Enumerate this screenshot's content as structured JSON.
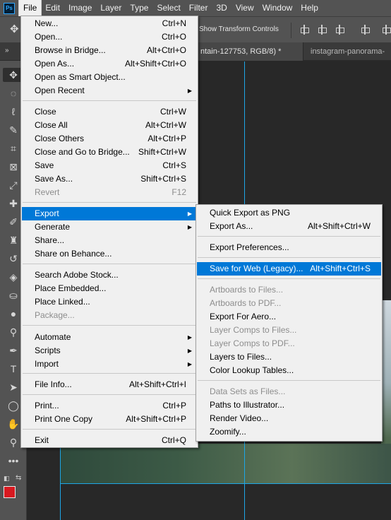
{
  "app": {
    "logo_text": "Ps"
  },
  "menubar": [
    "File",
    "Edit",
    "Image",
    "Layer",
    "Type",
    "Select",
    "Filter",
    "3D",
    "View",
    "Window",
    "Help"
  ],
  "options": {
    "transform_label": "Show Transform Controls"
  },
  "tabs": {
    "active": "ntain-127753, RGB/8) *",
    "inactive": "instagram-panorama-"
  },
  "file_menu": {
    "new": {
      "label": "New...",
      "shortcut": "Ctrl+N"
    },
    "open": {
      "label": "Open...",
      "shortcut": "Ctrl+O"
    },
    "browse_bridge": {
      "label": "Browse in Bridge...",
      "shortcut": "Alt+Ctrl+O"
    },
    "open_as": {
      "label": "Open As...",
      "shortcut": "Alt+Shift+Ctrl+O"
    },
    "open_smart": {
      "label": "Open as Smart Object..."
    },
    "open_recent": {
      "label": "Open Recent"
    },
    "close": {
      "label": "Close",
      "shortcut": "Ctrl+W"
    },
    "close_all": {
      "label": "Close All",
      "shortcut": "Alt+Ctrl+W"
    },
    "close_others": {
      "label": "Close Others",
      "shortcut": "Alt+Ctrl+P"
    },
    "close_bridge": {
      "label": "Close and Go to Bridge...",
      "shortcut": "Shift+Ctrl+W"
    },
    "save": {
      "label": "Save",
      "shortcut": "Ctrl+S"
    },
    "save_as": {
      "label": "Save As...",
      "shortcut": "Shift+Ctrl+S"
    },
    "revert": {
      "label": "Revert",
      "shortcut": "F12"
    },
    "export": {
      "label": "Export"
    },
    "generate": {
      "label": "Generate"
    },
    "share": {
      "label": "Share..."
    },
    "share_behance": {
      "label": "Share on Behance..."
    },
    "search_stock": {
      "label": "Search Adobe Stock..."
    },
    "place_embedded": {
      "label": "Place Embedded..."
    },
    "place_linked": {
      "label": "Place Linked..."
    },
    "package": {
      "label": "Package..."
    },
    "automate": {
      "label": "Automate"
    },
    "scripts": {
      "label": "Scripts"
    },
    "import": {
      "label": "Import"
    },
    "file_info": {
      "label": "File Info...",
      "shortcut": "Alt+Shift+Ctrl+I"
    },
    "print": {
      "label": "Print...",
      "shortcut": "Ctrl+P"
    },
    "print_one": {
      "label": "Print One Copy",
      "shortcut": "Alt+Shift+Ctrl+P"
    },
    "exit": {
      "label": "Exit",
      "shortcut": "Ctrl+Q"
    }
  },
  "export_menu": {
    "quick_export": {
      "label": "Quick Export as PNG"
    },
    "export_as": {
      "label": "Export As...",
      "shortcut": "Alt+Shift+Ctrl+W"
    },
    "export_prefs": {
      "label": "Export Preferences..."
    },
    "save_web": {
      "label": "Save for Web (Legacy)...",
      "shortcut": "Alt+Shift+Ctrl+S"
    },
    "artboards_files": {
      "label": "Artboards to Files..."
    },
    "artboards_pdf": {
      "label": "Artboards to PDF..."
    },
    "export_aero": {
      "label": "Export For Aero..."
    },
    "layer_comps_files": {
      "label": "Layer Comps to Files..."
    },
    "layer_comps_pdf": {
      "label": "Layer Comps to PDF..."
    },
    "layers_files": {
      "label": "Layers to Files..."
    },
    "color_lookup": {
      "label": "Color Lookup Tables..."
    },
    "data_sets": {
      "label": "Data Sets as Files..."
    },
    "paths_illustrator": {
      "label": "Paths to Illustrator..."
    },
    "render_video": {
      "label": "Render Video..."
    },
    "zoomify": {
      "label": "Zoomify..."
    }
  },
  "colors": {
    "accent": "#0078d7",
    "foreground_swatch": "#d71920",
    "background_swatch": "#ffffff",
    "guide": "#1ea6e6"
  }
}
